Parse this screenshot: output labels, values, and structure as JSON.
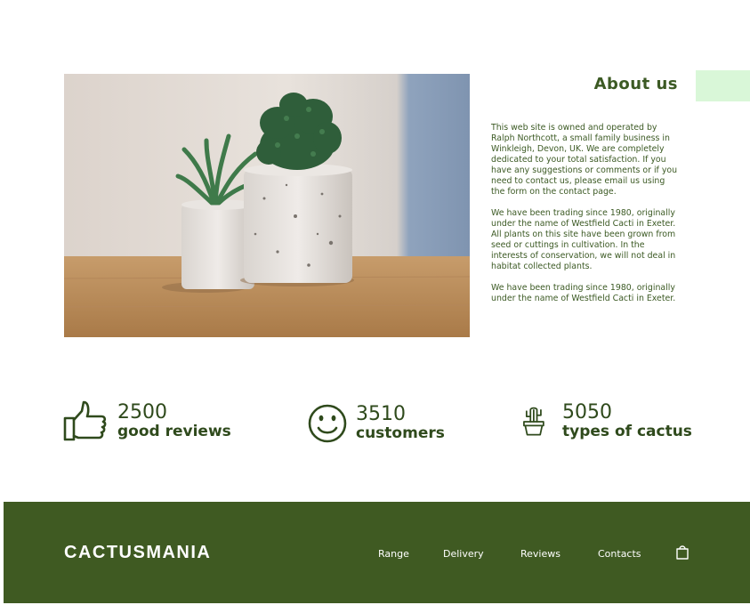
{
  "about": {
    "title": "About us",
    "paragraphs": [
      "This web site is owned and operated by Ralph Northcott, a small family business in Winkleigh, Devon, UK. We are completely dedicated to your total satisfaction. If you have any suggestions or comments or if you need to contact us, please email us using the form on the contact page.",
      "We have been trading since 1980, originally under the name of Westfield Cacti in Exeter.\nAll  plants on this site have been grown from seed or cuttings in cultivation. In the interests of conservation, we will not deal in habitat collected plants.",
      "We have been trading since 1980, originally under the name of Westfield Cacti in Exeter."
    ]
  },
  "stats": [
    {
      "number": "2500",
      "label": "good reviews",
      "icon": "thumbs-up-icon"
    },
    {
      "number": "3510",
      "label": "customers",
      "icon": "smiley-face-icon"
    },
    {
      "number": "5050",
      "label": "types of cactus",
      "icon": "cactus-pot-icon"
    }
  ],
  "footer": {
    "brand": "CACTUSMANIA",
    "nav": [
      "Range",
      "Delivery",
      "Reviews",
      "Contacts"
    ],
    "cart_icon": "shopping-bag-icon"
  },
  "colors": {
    "primary_green": "#3f5a22",
    "text_green": "#3c5a24",
    "accent_mint": "#d9f7d8"
  }
}
